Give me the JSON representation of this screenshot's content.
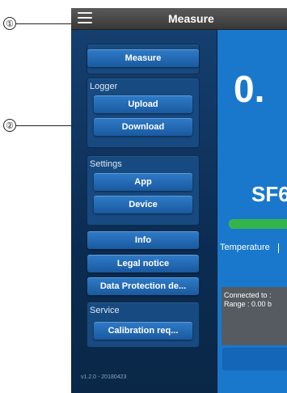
{
  "callouts": {
    "one": "①",
    "two": "②"
  },
  "titlebar": {
    "title": "Measure",
    "menu_icon": "hamburger-menu-icon"
  },
  "drawer": {
    "measure_label": "Measure",
    "logger": {
      "label": "Logger",
      "upload_label": "Upload",
      "download_label": "Download"
    },
    "settings": {
      "label": "Settings",
      "app_label": "App",
      "device_label": "Device"
    },
    "info_label": "Info",
    "legal_label": "Legal notice",
    "data_protection_label": "Data Protection de...",
    "service": {
      "label": "Service",
      "calibration_label": "Calibration req..."
    },
    "version": "v1.2.0 - 20180423"
  },
  "content": {
    "value": "0.",
    "gas": "SF6",
    "level_fraction": 0.9,
    "temperature_label": "Temperature",
    "status_line1": "Connected to :",
    "status_line2": "Range : 0.00 b"
  },
  "colors": {
    "accent": "#1a78cc",
    "drawer": "#0f3a66",
    "level": "#35b44a"
  }
}
